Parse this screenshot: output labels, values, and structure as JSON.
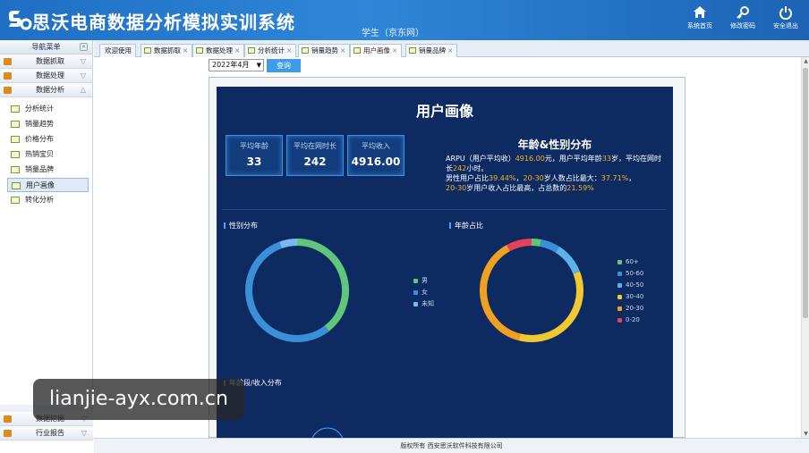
{
  "header": {
    "title": "思沃电商数据分析模拟实训系统",
    "user": "学生（京东网）",
    "buttons": [
      {
        "label": "系统首页",
        "icon": "home-icon"
      },
      {
        "label": "修改密码",
        "icon": "key-icon"
      },
      {
        "label": "安全退出",
        "icon": "power-icon"
      }
    ]
  },
  "sidebar": {
    "header": "导航菜单",
    "collapse_glyph": "«",
    "groups_top": [
      "数据抓取",
      "数据处理",
      "数据分析"
    ],
    "items": [
      "分析统计",
      "销量趋势",
      "价格分布",
      "热销宝贝",
      "销量品牌",
      "用户画像",
      "转化分析"
    ],
    "active_item": "用户画像",
    "groups_bottom": [
      "数据挖掘",
      "行业报告"
    ]
  },
  "tabs": [
    {
      "label": "欢迎使用",
      "closable": false
    },
    {
      "label": "数据抓取",
      "closable": true
    },
    {
      "label": "数据处理",
      "closable": true
    },
    {
      "label": "分析统计",
      "closable": true
    },
    {
      "label": "销量趋势",
      "closable": true
    },
    {
      "label": "用户画像",
      "closable": true,
      "active": true
    },
    {
      "label": "销量品牌",
      "closable": true
    }
  ],
  "toolbar": {
    "month": "2022年4月",
    "query_label": "查询"
  },
  "dashboard": {
    "title": "用户画像",
    "stats": [
      {
        "label": "平均年龄",
        "value": "33"
      },
      {
        "label": "平均在网时长",
        "value": "242"
      },
      {
        "label": "平均收入",
        "value": "4916.00"
      }
    ],
    "section_title": "年龄&性别分布",
    "desc": {
      "p1": "ARPU（用户平均收）",
      "arpu": "4916.00",
      "p2": "元，用户平均年龄",
      "age": "33",
      "p3": "岁，平均在网时长",
      "tenure": "242",
      "p4": "小时。",
      "p5": "男性用户占比",
      "male_pct": "39.44%",
      "p6": "，",
      "age_range1": "20-30",
      "p7": "岁人数占比最大：",
      "max_pct": "37.71%",
      "p8": "，",
      "age_range2": "20-30",
      "p9": "岁用户收入占比最高，占总数的",
      "income_pct": "21.59%"
    },
    "gender_chart_title": "性别分布",
    "age_chart_title": "年龄占比",
    "income_chart_title": "年龄段/收入分布"
  },
  "chart_data": [
    {
      "type": "pie",
      "title": "性别分布",
      "labels": [
        "男",
        "女",
        "未知"
      ],
      "values": [
        39.44,
        55.0,
        5.56
      ],
      "colors": [
        "#5fc67a",
        "#3a8fd8",
        "#7ab8f0"
      ]
    },
    {
      "type": "pie",
      "title": "年龄占比",
      "labels": [
        "60+",
        "50-60",
        "40-50",
        "30-40",
        "20-30",
        "0-20"
      ],
      "values": [
        3,
        6,
        10,
        35,
        38,
        8
      ],
      "colors": [
        "#5fc67a",
        "#3a8fd8",
        "#5ab4e8",
        "#f0c930",
        "#f0a020",
        "#e8405a"
      ]
    }
  ],
  "footer": "版权所有 西安思沃软件科技有限公司",
  "watermark": "lianjie-ayx.com.cn"
}
